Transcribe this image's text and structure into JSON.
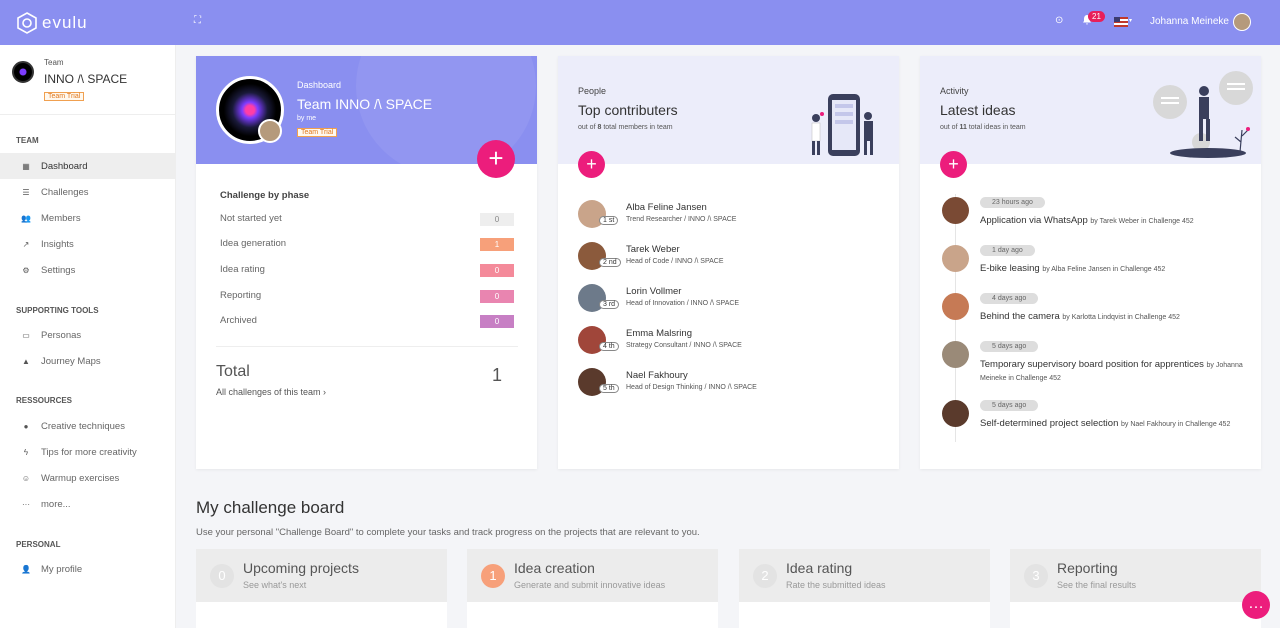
{
  "app": {
    "name": "evulu"
  },
  "topbar": {
    "notification_count": "21",
    "user_name": "Johanna Meineke"
  },
  "sidebar": {
    "team_label": "Team",
    "team_name": "INNO /\\ SPACE",
    "trial_badge": "Team Trial",
    "sections": {
      "team": "TEAM",
      "tools": "SUPPORTING TOOLS",
      "resources": "RESSOURCES",
      "personal": "PERSONAL"
    },
    "items": [
      {
        "label": "Dashboard",
        "icon": "grid-icon"
      },
      {
        "label": "Challenges",
        "icon": "list-icon"
      },
      {
        "label": "Members",
        "icon": "users-icon"
      },
      {
        "label": "Insights",
        "icon": "chart-icon"
      },
      {
        "label": "Settings",
        "icon": "gear-icon"
      },
      {
        "label": "Personas",
        "icon": "id-card-icon"
      },
      {
        "label": "Journey Maps",
        "icon": "route-icon"
      },
      {
        "label": "Creative techniques",
        "icon": "bulb-icon"
      },
      {
        "label": "Tips for more creativity",
        "icon": "flash-icon"
      },
      {
        "label": "Warmup exercises",
        "icon": "smile-icon"
      },
      {
        "label": "more...",
        "icon": "more-icon"
      },
      {
        "label": "My profile",
        "icon": "user-icon"
      }
    ]
  },
  "dashboard_card": {
    "kicker": "Dashboard",
    "title": "Team INNO /\\ SPACE",
    "by": "by me",
    "trial": "Team Trial",
    "phase_title": "Challenge by phase",
    "phases": [
      {
        "label": "Not started yet",
        "value": "0",
        "color": "#eeeeee"
      },
      {
        "label": "Idea generation",
        "value": "1",
        "color": "#f7a07a"
      },
      {
        "label": "Idea rating",
        "value": "0",
        "color": "#f48a9a"
      },
      {
        "label": "Reporting",
        "value": "0",
        "color": "#e985b0"
      },
      {
        "label": "Archived",
        "value": "0",
        "color": "#c77fc4"
      }
    ],
    "total_label": "Total",
    "total_value": "1",
    "all_link": "All challenges of this team ›"
  },
  "people_card": {
    "kicker": "People",
    "title": "Top contributers",
    "sub_pre": "out of ",
    "sub_num": "8",
    "sub_post": " total members in team",
    "people": [
      {
        "name": "Alba Feline Jansen",
        "role": "Trend Researcher / INNO /\\ SPACE",
        "rank": "1 st",
        "color": "#c9a48a"
      },
      {
        "name": "Tarek Weber",
        "role": "Head of Code / INNO /\\ SPACE",
        "rank": "2 nd",
        "color": "#8b5a3c"
      },
      {
        "name": "Lorin Vollmer",
        "role": "Head of Innovation / INNO /\\ SPACE",
        "rank": "3 rd",
        "color": "#6d7a8a"
      },
      {
        "name": "Emma Malsring",
        "role": "Strategy Consultant / INNO /\\ SPACE",
        "rank": "4 th",
        "color": "#a0463a"
      },
      {
        "name": "Nael Fakhoury",
        "role": "Head of Design Thinking / INNO /\\ SPACE",
        "rank": "5 th",
        "color": "#5a3a2c"
      }
    ]
  },
  "activity_card": {
    "kicker": "Activity",
    "title": "Latest ideas",
    "sub_pre": "out of ",
    "sub_num": "11",
    "sub_post": " total ideas in team",
    "ideas": [
      {
        "time": "23 hours ago",
        "title": "Application via WhatsApp",
        "meta": "by Tarek Weber in Challenge 452",
        "color": "#7a4a34"
      },
      {
        "time": "1 day ago",
        "title": "E-bike leasing",
        "meta": "by Alba Feline Jansen in Challenge 452",
        "color": "#c9a48a"
      },
      {
        "time": "4 days ago",
        "title": "Behind the camera",
        "meta": "by Karlotta Lindqvist in Challenge 452",
        "color": "#c67a55"
      },
      {
        "time": "5 days ago",
        "title": "Temporary supervisory board position for apprentices",
        "meta": "by Johanna Meineke in Challenge 452",
        "color": "#9a8a78"
      },
      {
        "time": "5 days ago",
        "title": "Self-determined project selection",
        "meta": "by Nael Fakhoury in Challenge 452",
        "color": "#5a3a2c"
      }
    ]
  },
  "board": {
    "title": "My challenge board",
    "subtitle": "Use your personal \"Challenge Board\" to complete your tasks and track progress on the projects that are relevant to you.",
    "columns": [
      {
        "num": "0",
        "title": "Upcoming projects",
        "sub": "See what's next"
      },
      {
        "num": "1",
        "title": "Idea creation",
        "sub": "Generate and submit innovative ideas"
      },
      {
        "num": "2",
        "title": "Idea rating",
        "sub": "Rate the submitted ideas"
      },
      {
        "num": "3",
        "title": "Reporting",
        "sub": "See the final results"
      }
    ]
  }
}
